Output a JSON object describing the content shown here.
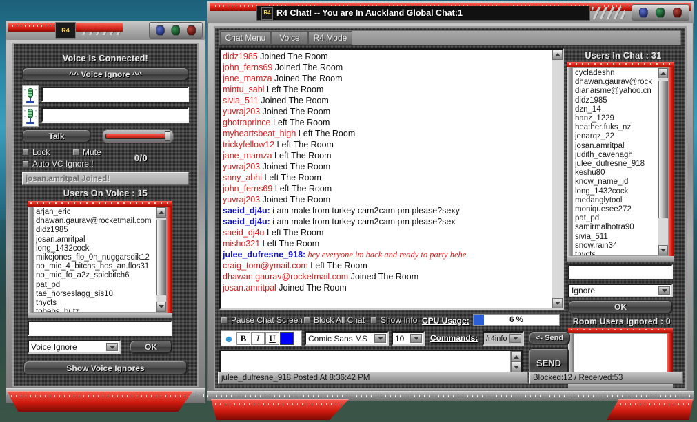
{
  "voice_window": {
    "title_icon": "r4-skull-icon",
    "heading": "Voice Is Connected!",
    "voice_ignore_button": "^^ Voice Ignore ^^",
    "mic_icon_1": "microphone-icon",
    "mic_icon_2": "microphone-icon",
    "field1_value": "",
    "field2_value": "",
    "talk_button": "Talk",
    "checkboxes": [
      {
        "label": "Lock",
        "checked": false
      },
      {
        "label": "Mute",
        "checked": false
      },
      {
        "label": "Auto VC Ignore!!",
        "checked": false
      }
    ],
    "ratio": "0/0",
    "status_line": "josan.amritpal Joined!",
    "users_on_voice_header": "Users On Voice : 15",
    "voice_users": [
      "arjan_eric",
      "dhawan.gaurav@rocketmail.com",
      "didz1985",
      "josan.amritpal",
      "long_1432cock",
      "mikejones_flo_0n_nuggarsdik12",
      "no_mic_4_bitchs_hos_an.flos31",
      "no_mic_fo_a2z_spicbitch6",
      "pat_pd",
      "tae_horseslagg_sis10",
      "tnycts",
      "tobebs_butz"
    ],
    "selection_value": "",
    "action_combo_value": "Voice Ignore",
    "ok_button": "OK",
    "show_voice_ignores_button": "Show Voice Ignores",
    "gems": [
      "blue",
      "green",
      "red"
    ]
  },
  "chat_window": {
    "title": "R4 Chat!  --  You are In Auckland Global Chat:1",
    "title_icon": "r4-skull-icon",
    "gems": [
      "blue",
      "green",
      "red"
    ],
    "tabs": [
      "Chat Menu",
      "Voice",
      "R4 Mode"
    ],
    "messages": [
      {
        "user": "didz1985",
        "text": " Joined The Room",
        "kind": "system"
      },
      {
        "user": "john_ferns69",
        "text": " Joined The Room",
        "kind": "system"
      },
      {
        "user": "jane_mamza",
        "text": " Joined The Room",
        "kind": "system"
      },
      {
        "user": "mintu_sabl",
        "text": " Left The Room",
        "kind": "system"
      },
      {
        "user": "sivia_511",
        "text": " Joined The Room",
        "kind": "system"
      },
      {
        "user": "yuvraj203",
        "text": " Joined The Room",
        "kind": "system"
      },
      {
        "user": "ghotraprince",
        "text": " Left The Room",
        "kind": "system"
      },
      {
        "user": "myheartsbeat_high",
        "text": " Left The Room",
        "kind": "system"
      },
      {
        "user": "trickyfellow12",
        "text": " Left The Room",
        "kind": "system"
      },
      {
        "user": "jane_mamza",
        "text": " Left The Room",
        "kind": "system"
      },
      {
        "user": "yuvraj203",
        "text": " Joined The Room",
        "kind": "system"
      },
      {
        "user": "snny_abhi",
        "text": " Left The Room",
        "kind": "system"
      },
      {
        "user": "john_ferns69",
        "text": " Left The Room",
        "kind": "system"
      },
      {
        "user": "yuvraj203",
        "text": " Joined The Room",
        "kind": "system"
      },
      {
        "user": "saeid_dj4u:",
        "text": " i am male from turkey cam2cam pm please?sexy",
        "kind": "message"
      },
      {
        "user": "saeid_dj4u:",
        "text": " i am male from turkey cam2cam pm please?sex",
        "kind": "message"
      },
      {
        "user": "saeid_dj4u",
        "text": " Left The Room",
        "kind": "system"
      },
      {
        "user": "misho321",
        "text": " Left The Room",
        "kind": "system"
      },
      {
        "user": "julee_dufresne_918:",
        "text": " hey everyone im back and ready to party hehe",
        "kind": "fancy"
      },
      {
        "user": "craig_tom@ymail.com",
        "text": " Left The Room",
        "kind": "system"
      },
      {
        "user": "dhawan.gaurav@rocketmail.com",
        "text": " Joined The Room",
        "kind": "system"
      },
      {
        "user": "josan.amritpal",
        "text": " Joined The Room",
        "kind": "system"
      }
    ],
    "users_header": "Users In Chat : 31",
    "users": [
      "cycladeshn",
      "dhawan.gaurav@rock",
      "dianaisme@yahoo.cn",
      "didz1985",
      "dzn_14",
      "hanz_1229",
      "heather.fuks_nz",
      "jenarqz_22",
      "josan.amritpal",
      "judith_cavenagh",
      "julee_dufresne_918",
      "keshu80",
      "know_name_id",
      "long_1432cock",
      "medanglytool",
      "moniquesee272",
      "pat_pd",
      "samirmalhotra90",
      "sivia_511",
      "snow.rain34",
      "tnycts"
    ],
    "user_selection_value": "",
    "user_action_combo": "Ignore",
    "user_ok_button": "OK",
    "room_users_ignored_header": "Room Users Ignored : 0",
    "ignored_users": [],
    "options": [
      {
        "label": "Pause Chat Screen",
        "checked": false
      },
      {
        "label": "Block All Chat",
        "checked": false
      },
      {
        "label": "Show Info",
        "checked": false
      }
    ],
    "cpu_label": "CPU Usage:",
    "cpu_value": "6 %",
    "cpu_percent": 6,
    "cpu_bar_color": "#2a5fd6",
    "format": {
      "emoticon_icon": "smiley-face-icon",
      "bold": "B",
      "italic": "I",
      "underline": "U",
      "color_swatch": "#0000ff",
      "font_name": "Comic Sans MS",
      "font_size": "10"
    },
    "commands_label": "Commands:",
    "commands_value": "/r4info",
    "send_arrow_button": "<- Send",
    "send_button": "SEND",
    "message_input_value": "",
    "status_left": "julee_dufresne_918 Posted At 8:36:42 PM",
    "status_right": "Blocked:12 / Received:53"
  }
}
